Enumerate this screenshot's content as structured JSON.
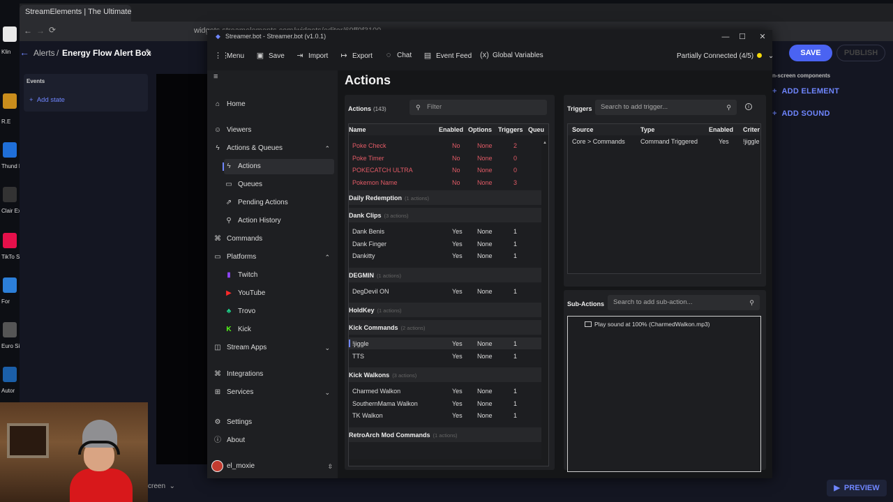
{
  "browser": {
    "tab_title": "StreamElements | The Ultimate S",
    "address": "widgets.streamelements.com/widgets/editor/69ff9f3100..."
  },
  "desktop": {
    "icons": [
      "Klin",
      "R.E",
      "Thund Mod",
      "Clair Exped",
      "TikTo Stu",
      "For",
      "Euro Simu",
      "Autor"
    ]
  },
  "streamelements": {
    "breadcrumb_parent": "Alerts",
    "breadcrumb_sep": "/",
    "widget_title": "Energy Flow Alert Box",
    "events_label": "Events",
    "add_state": "Add state",
    "save": "SAVE",
    "publish": "PUBLISH",
    "onscreen_label": "n-screen components",
    "add_element": "ADD ELEMENT",
    "add_sound": "ADD SOUND",
    "preview": "PREVIEW",
    "screen_label": "creen"
  },
  "streamerbot": {
    "window_title": "Streamer.bot - Streamer.bot (v1.0.1)",
    "menu": {
      "menu": "Menu",
      "save": "Save",
      "import": "Import",
      "export": "Export",
      "chat": "Chat",
      "event_feed": "Event Feed",
      "global_variables": "Global Variables"
    },
    "connection": "Partially Connected (4/5)",
    "nav": {
      "home": "Home",
      "viewers": "Viewers",
      "actions_queues": "Actions & Queues",
      "actions": "Actions",
      "queues": "Queues",
      "pending_actions": "Pending Actions",
      "action_history": "Action History",
      "commands": "Commands",
      "platforms": "Platforms",
      "twitch": "Twitch",
      "youtube": "YouTube",
      "trovo": "Trovo",
      "kick": "Kick",
      "stream_apps": "Stream Apps",
      "integrations": "Integrations",
      "services": "Services",
      "settings": "Settings",
      "about": "About",
      "user": "el_moxie"
    },
    "page_title": "Actions",
    "actions_panel": {
      "title": "Actions",
      "count": "(143)",
      "filter_placeholder": "Filter",
      "columns": [
        "Name",
        "Enabled",
        "Options",
        "Triggers",
        "Queu"
      ],
      "red_rows": [
        {
          "name": "Poke Check",
          "enabled": "No",
          "options": "None",
          "triggers": "2"
        },
        {
          "name": "Poke Timer",
          "enabled": "No",
          "options": "None",
          "triggers": "0"
        },
        {
          "name": "POKECATCH ULTRA",
          "enabled": "No",
          "options": "None",
          "triggers": "0"
        },
        {
          "name": "Pokemon Name",
          "enabled": "No",
          "options": "None",
          "triggers": "3"
        }
      ],
      "groups": [
        {
          "name": "Daily Redemption",
          "count": "(1 actions)",
          "rows": []
        },
        {
          "name": "Dank Clips",
          "count": "(3 actions)",
          "rows": [
            {
              "name": "Dank Benis",
              "enabled": "Yes",
              "options": "None",
              "triggers": "1"
            },
            {
              "name": "Dank Finger",
              "enabled": "Yes",
              "options": "None",
              "triggers": "1"
            },
            {
              "name": "Dankitty",
              "enabled": "Yes",
              "options": "None",
              "triggers": "1"
            }
          ]
        },
        {
          "name": "DEGMIN",
          "count": "(1 actions)",
          "rows": [
            {
              "name": "DegDevil ON",
              "enabled": "Yes",
              "options": "None",
              "triggers": "1"
            }
          ]
        },
        {
          "name": "HoldKey",
          "count": "(1 actions)",
          "rows": []
        },
        {
          "name": "Kick Commands",
          "count": "(2 actions)",
          "rows": [
            {
              "name": "!jiggle",
              "enabled": "Yes",
              "options": "None",
              "triggers": "1",
              "selected": true
            },
            {
              "name": "TTS",
              "enabled": "Yes",
              "options": "None",
              "triggers": "1"
            }
          ]
        },
        {
          "name": "Kick Walkons",
          "count": "(3 actions)",
          "rows": [
            {
              "name": "Charmed Walkon",
              "enabled": "Yes",
              "options": "None",
              "triggers": "1"
            },
            {
              "name": "SouthernMama Walkon",
              "enabled": "Yes",
              "options": "None",
              "triggers": "1"
            },
            {
              "name": "TK Walkon",
              "enabled": "Yes",
              "options": "None",
              "triggers": "1"
            }
          ]
        },
        {
          "name": "RetroArch Mod Commands",
          "count": "(1 actions)",
          "rows": []
        }
      ]
    },
    "triggers_panel": {
      "title": "Triggers",
      "search_placeholder": "Search to add trigger...",
      "columns": [
        "Source",
        "Type",
        "Enabled",
        "Criter"
      ],
      "rows": [
        {
          "source": "Core > Commands",
          "type": "Command Triggered",
          "enabled": "Yes",
          "criteria": "!jiggle"
        }
      ]
    },
    "subactions_panel": {
      "title": "Sub-Actions",
      "search_placeholder": "Search to add sub-action...",
      "items": [
        "Play sound at 100% (CharmedWalkon.mp3)"
      ]
    }
  }
}
